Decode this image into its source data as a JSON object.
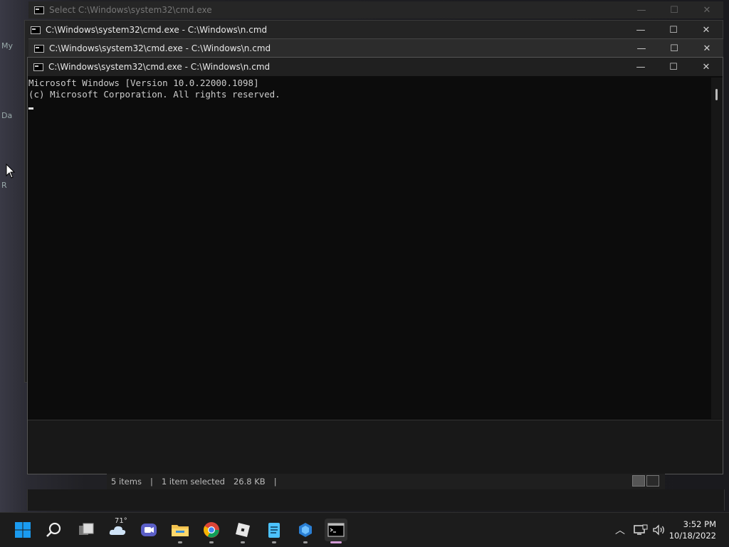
{
  "windows": {
    "back_title": "Select C:\\Windows\\system32\\cmd.exe",
    "w2_title": "C:\\Windows\\system32\\cmd.exe - C:\\Windows\\n.cmd",
    "w3_title": "C:\\Windows\\system32\\cmd.exe - C:\\Windows\\n.cmd",
    "front_title": "C:\\Windows\\system32\\cmd.exe - C:\\Windows\\n.cmd"
  },
  "console": {
    "line1": "Microsoft Windows [Version 10.0.22000.1098]",
    "line2": "(c) Microsoft Corporation. All rights reserved."
  },
  "explorer_status": {
    "items": "5 items",
    "selection": "1 item selected",
    "size": "26.8 KB"
  },
  "desktop_fragments": {
    "a": "My",
    "b": "Da",
    "c": "R"
  },
  "taskbar": {
    "items": [
      "start",
      "search",
      "task-view",
      "weather",
      "meet",
      "file-explorer",
      "chrome",
      "roblox",
      "notepad",
      "app",
      "terminal"
    ],
    "weather_temp": "71°",
    "time": "3:52 PM",
    "date": "10/18/2022"
  },
  "colors": {
    "console_bg": "#0c0c0c",
    "console_fg": "#cccccc",
    "taskbar_bg": "#1c1c1c",
    "start_blue": "#1a9bf0"
  }
}
